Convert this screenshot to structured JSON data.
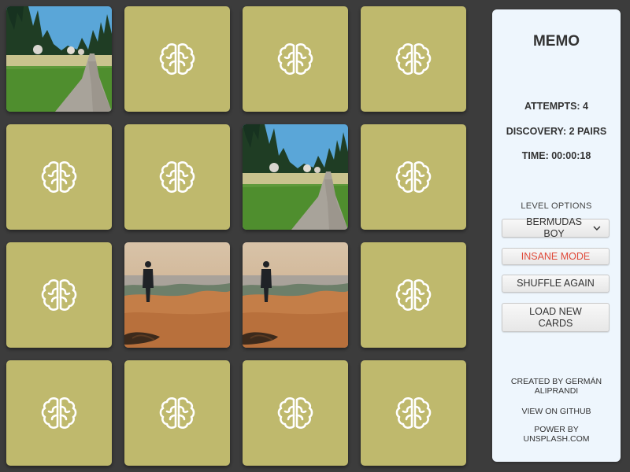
{
  "panel": {
    "title": "MEMO",
    "attempts": "ATTEMPTS: 4",
    "discovery": "DISCOVERY: 2 PAIRS",
    "time": "TIME: 00:00:18",
    "level_label": "LEVEL OPTIONS",
    "level_selected": "BERMUDAS BOY",
    "insane_mode": "INSANE MODE",
    "shuffle": "SHUFFLE AGAIN",
    "load_new": "LOAD NEW CARDS",
    "credit": "CREATED BY GERMÁN ALIPRANDI",
    "github": "VIEW ON GITHUB",
    "powered": "POWER BY UNSPLASH.COM"
  },
  "board": {
    "columns": 4,
    "rows": 4,
    "cards": [
      {
        "state": "revealed",
        "image": "forest-path"
      },
      {
        "state": "hidden",
        "icon": "brain-icon"
      },
      {
        "state": "hidden",
        "icon": "brain-icon"
      },
      {
        "state": "hidden",
        "icon": "brain-icon"
      },
      {
        "state": "hidden",
        "icon": "brain-icon"
      },
      {
        "state": "hidden",
        "icon": "brain-icon"
      },
      {
        "state": "revealed",
        "image": "forest-path"
      },
      {
        "state": "hidden",
        "icon": "brain-icon"
      },
      {
        "state": "hidden",
        "icon": "brain-icon"
      },
      {
        "state": "revealed",
        "image": "man-on-shore"
      },
      {
        "state": "revealed",
        "image": "man-on-shore"
      },
      {
        "state": "hidden",
        "icon": "brain-icon"
      },
      {
        "state": "hidden",
        "icon": "brain-icon"
      },
      {
        "state": "hidden",
        "icon": "brain-icon"
      },
      {
        "state": "hidden",
        "icon": "brain-icon"
      },
      {
        "state": "hidden",
        "icon": "brain-icon"
      }
    ]
  },
  "colors": {
    "background": "#3c3c3c",
    "card_back": "#bfb96d",
    "panel": "#eef6fd",
    "danger_text": "#e04a3a"
  }
}
